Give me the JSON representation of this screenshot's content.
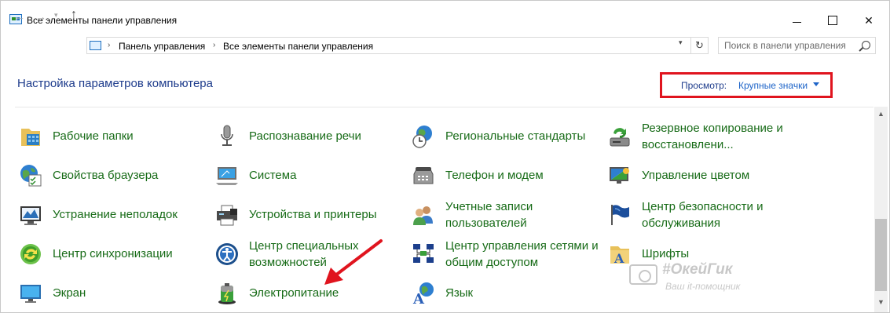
{
  "window": {
    "title": "Все элементы панели управления"
  },
  "address_bar": {
    "crumbs": [
      "Панель управления",
      "Все элементы панели управления"
    ]
  },
  "search": {
    "placeholder": "Поиск в панели управления"
  },
  "header": {
    "title": "Настройка параметров компьютера",
    "view_label": "Просмотр:",
    "view_value": "Крупные значки"
  },
  "items": [
    {
      "label": "Рабочие папки",
      "icon": "work-folders-icon"
    },
    {
      "label": "Распознавание речи",
      "icon": "microphone-icon"
    },
    {
      "label": "Региональные стандарты",
      "icon": "region-clock-icon"
    },
    {
      "label": "Резервное копирование и восстановлени...",
      "icon": "backup-icon"
    },
    {
      "label": "Свойства браузера",
      "icon": "internet-options-icon"
    },
    {
      "label": "Система",
      "icon": "computer-icon"
    },
    {
      "label": "Телефон и модем",
      "icon": "phone-modem-icon"
    },
    {
      "label": "Управление цветом",
      "icon": "color-management-icon"
    },
    {
      "label": "Устранение неполадок",
      "icon": "troubleshooting-icon"
    },
    {
      "label": "Устройства и принтеры",
      "icon": "printer-icon"
    },
    {
      "label": "Учетные записи пользователей",
      "icon": "user-accounts-icon"
    },
    {
      "label": "Центр безопасности и обслуживания",
      "icon": "security-flag-icon"
    },
    {
      "label": "Центр синхронизации",
      "icon": "sync-icon"
    },
    {
      "label": "Центр специальных возможностей",
      "icon": "ease-of-access-icon"
    },
    {
      "label": "Центр управления сетями и общим доступом",
      "icon": "network-icon"
    },
    {
      "label": "Шрифты",
      "icon": "fonts-icon"
    },
    {
      "label": "Экран",
      "icon": "display-icon"
    },
    {
      "label": "Электропитание",
      "icon": "battery-power-icon"
    },
    {
      "label": "Язык",
      "icon": "language-icon"
    }
  ],
  "watermark": {
    "title": "#ОкейГик",
    "subtitle": "Ваш it-помощник"
  },
  "colors": {
    "link_green": "#176b17",
    "title_blue": "#1e3c8c",
    "highlight_red": "#e0141e"
  }
}
